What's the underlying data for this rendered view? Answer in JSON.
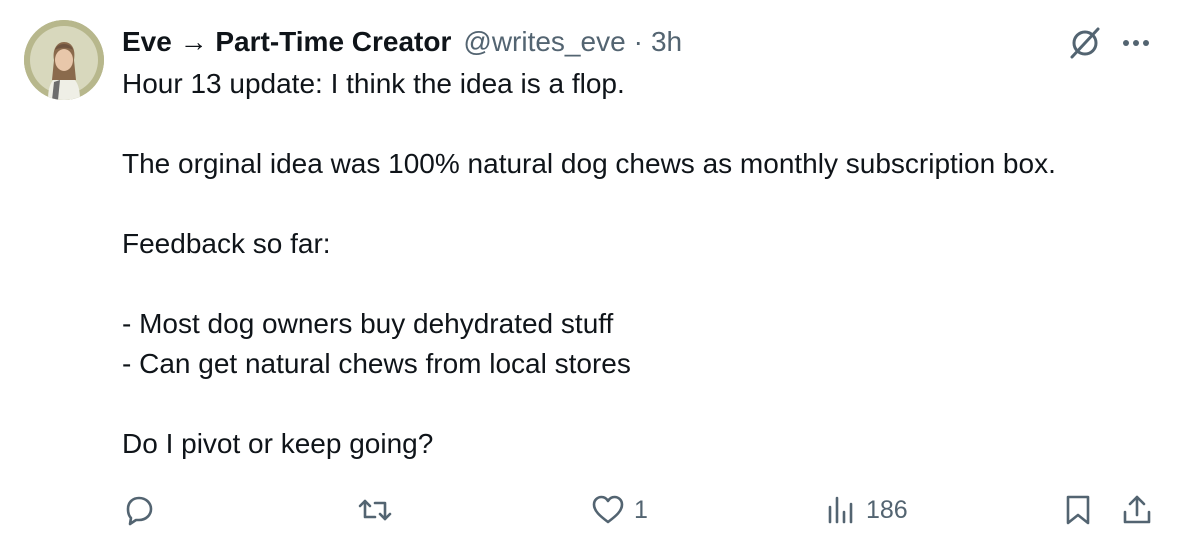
{
  "tweet": {
    "author": {
      "display_name": "Eve → Part-Time Creator",
      "handle": "@writes_eve",
      "separator": "·",
      "time": "3h",
      "avatar_icon": "profile-photo"
    },
    "lines": [
      "Hour 13 update: I think the idea is a flop.",
      "",
      "The orginal idea was 100% natural dog chews as monthly subscription box.",
      "",
      "Feedback so far:",
      "",
      "- Most dog owners buy dehydrated stuff",
      "- Can get natural chews from local stores",
      "",
      "Do I pivot or keep going?"
    ],
    "header_icons": [
      "grok-icon",
      "more-icon"
    ],
    "actions": {
      "reply": {
        "icon": "reply-icon",
        "count": ""
      },
      "repost": {
        "icon": "repost-icon",
        "count": ""
      },
      "like": {
        "icon": "heart-icon",
        "count": "1"
      },
      "views": {
        "icon": "views-icon",
        "count": "186"
      },
      "bookmark": {
        "icon": "bookmark-icon",
        "count": ""
      },
      "share": {
        "icon": "share-icon",
        "count": ""
      }
    }
  },
  "colors": {
    "text": "#0f1419",
    "muted": "#536471",
    "background": "#ffffff"
  }
}
